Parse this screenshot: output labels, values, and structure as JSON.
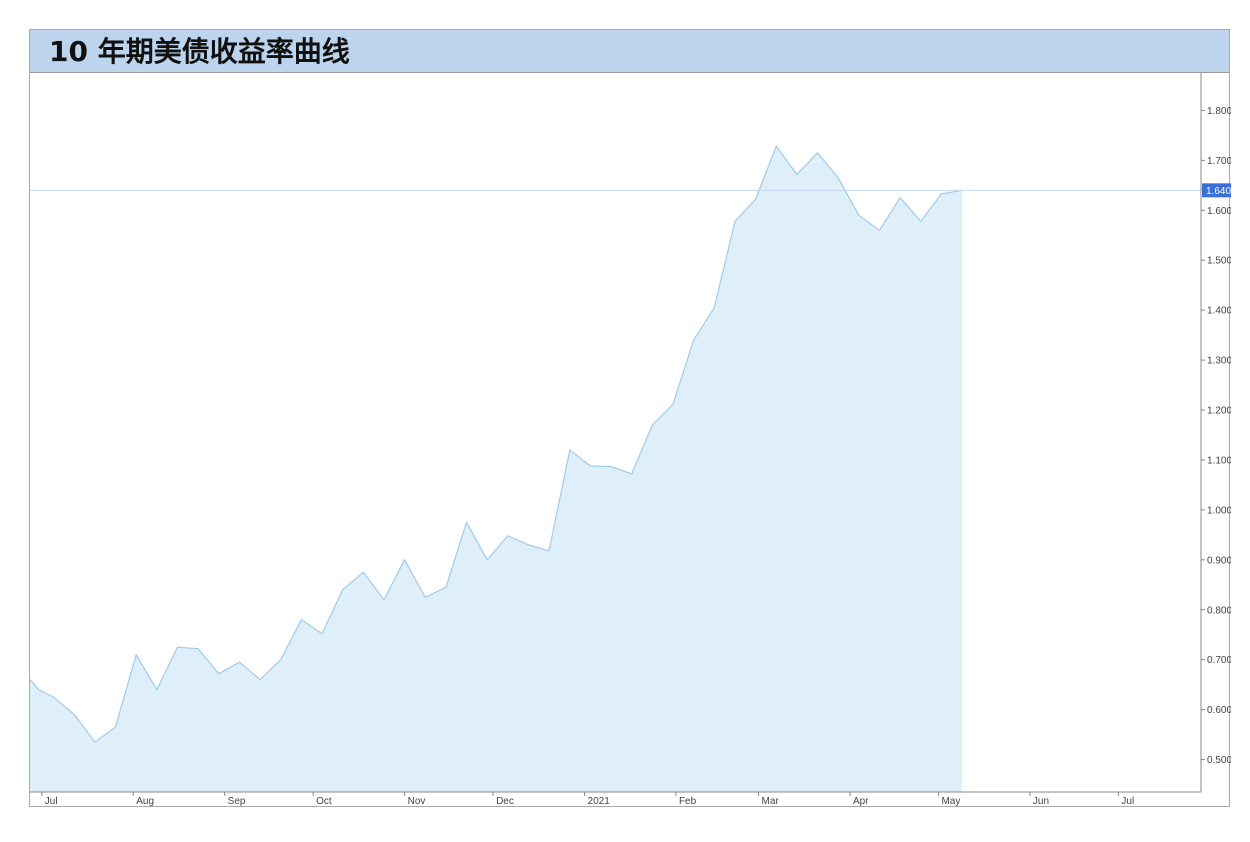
{
  "title": "10 年期美债收益率曲线",
  "colors": {
    "header_bg": "#bcd4ee",
    "line": "#9fcbea",
    "area": "#dfeffa",
    "reference_line": "#c6d8f5",
    "last_value_badge": "#3b6fd8"
  },
  "chart_data": {
    "type": "area",
    "title": "10 年期美债收益率曲线",
    "xlabel": "",
    "ylabel": "",
    "x_ticks": [
      "Jul",
      "Aug",
      "Sep",
      "Oct",
      "Nov",
      "Dec",
      "2021",
      "Feb",
      "Mar",
      "Apr",
      "May",
      "Jun",
      "Jul"
    ],
    "x_tick_dates": [
      "2020-07-01",
      "2020-08-01",
      "2020-09-01",
      "2020-10-01",
      "2020-11-01",
      "2020-12-01",
      "2021-01-01",
      "2021-02-01",
      "2021-03-01",
      "2021-04-01",
      "2021-05-01",
      "2021-06-01",
      "2021-07-01"
    ],
    "y_ticks": [
      "0.500",
      "0.600",
      "0.700",
      "0.800",
      "0.900",
      "1.000",
      "1.100",
      "1.200",
      "1.300",
      "1.400",
      "1.500",
      "1.600",
      "1.700",
      "1.800"
    ],
    "y_axis_position": "right",
    "ylim": [
      0.435,
      1.875
    ],
    "xlim": [
      "2020-06-27",
      "2021-07-29"
    ],
    "grid": false,
    "last_value_label": "1.640",
    "series": [
      {
        "points": [
          [
            "2020-06-27",
            0.66
          ],
          [
            "2020-06-30",
            0.64
          ],
          [
            "2020-07-05",
            0.625
          ],
          [
            "2020-07-12",
            0.59
          ],
          [
            "2020-07-19",
            0.535
          ],
          [
            "2020-07-26",
            0.565
          ],
          [
            "2020-08-02",
            0.71
          ],
          [
            "2020-08-09",
            0.64
          ],
          [
            "2020-08-16",
            0.725
          ],
          [
            "2020-08-23",
            0.722
          ],
          [
            "2020-08-30",
            0.672
          ],
          [
            "2020-09-06",
            0.695
          ],
          [
            "2020-09-13",
            0.66
          ],
          [
            "2020-09-20",
            0.7
          ],
          [
            "2020-09-27",
            0.78
          ],
          [
            "2020-10-04",
            0.752
          ],
          [
            "2020-10-11",
            0.84
          ],
          [
            "2020-10-18",
            0.875
          ],
          [
            "2020-10-25",
            0.82
          ],
          [
            "2020-11-01",
            0.9
          ],
          [
            "2020-11-08",
            0.825
          ],
          [
            "2020-11-15",
            0.845
          ],
          [
            "2020-11-22",
            0.975
          ],
          [
            "2020-11-29",
            0.9
          ],
          [
            "2020-12-06",
            0.948
          ],
          [
            "2020-12-13",
            0.93
          ],
          [
            "2020-12-20",
            0.918
          ],
          [
            "2020-12-27",
            1.12
          ],
          [
            "2021-01-03",
            1.088
          ],
          [
            "2021-01-10",
            1.087
          ],
          [
            "2021-01-17",
            1.072
          ],
          [
            "2021-01-24",
            1.17
          ],
          [
            "2021-01-31",
            1.212
          ],
          [
            "2021-02-07",
            1.34
          ],
          [
            "2021-02-14",
            1.405
          ],
          [
            "2021-02-21",
            1.578
          ],
          [
            "2021-02-28",
            1.622
          ],
          [
            "2021-03-07",
            1.728
          ],
          [
            "2021-03-14",
            1.672
          ],
          [
            "2021-03-21",
            1.715
          ],
          [
            "2021-03-28",
            1.665
          ],
          [
            "2021-04-04",
            1.59
          ],
          [
            "2021-04-11",
            1.56
          ],
          [
            "2021-04-18",
            1.625
          ],
          [
            "2021-04-25",
            1.578
          ],
          [
            "2021-05-02",
            1.633
          ],
          [
            "2021-05-09",
            1.64
          ]
        ]
      }
    ]
  }
}
